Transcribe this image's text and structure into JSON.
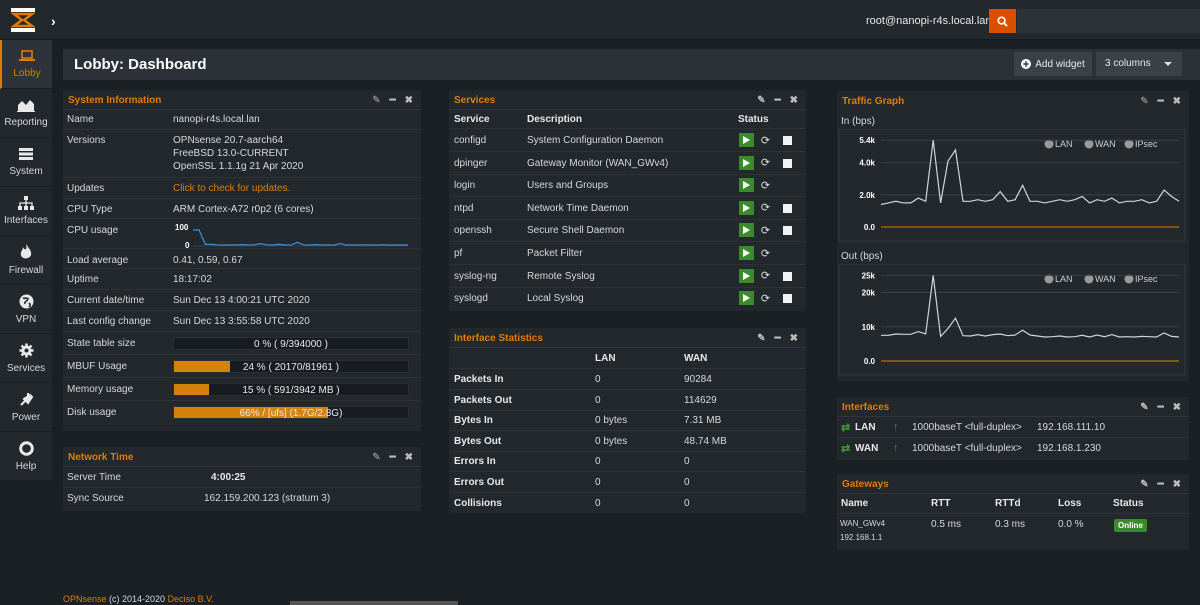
{
  "top": {
    "user": "root@nanopi-r4s.local.lan",
    "search_placeholder": ""
  },
  "sidebar": {
    "items": [
      {
        "label": "Lobby",
        "icon": "laptop-icon"
      },
      {
        "label": "Reporting",
        "icon": "area-chart-icon"
      },
      {
        "label": "System",
        "icon": "server-icon"
      },
      {
        "label": "Interfaces",
        "icon": "sitemap-icon"
      },
      {
        "label": "Firewall",
        "icon": "fire-icon"
      },
      {
        "label": "VPN",
        "icon": "globe-icon"
      },
      {
        "label": "Services",
        "icon": "cog-icon"
      },
      {
        "label": "Power",
        "icon": "plug-icon"
      },
      {
        "label": "Help",
        "icon": "lifebuoy-icon"
      }
    ]
  },
  "header": {
    "title": "Lobby: Dashboard",
    "add_widget": "Add widget",
    "columns": "3 columns"
  },
  "sysinfo": {
    "title": "System Information",
    "name_label": "Name",
    "name": "nanopi-r4s.local.lan",
    "versions_label": "Versions",
    "versions": [
      "OPNsense 20.7-aarch64",
      "FreeBSD 13.0-CURRENT",
      "OpenSSL 1.1.1g 21 Apr 2020"
    ],
    "updates_label": "Updates",
    "updates": "Click to check for updates.",
    "cpu_type_label": "CPU Type",
    "cpu_type": "ARM Cortex-A72 r0p2 (6 cores)",
    "cpu_usage_label": "CPU usage",
    "cpu_max": "100",
    "cpu_min": "0",
    "cpu_series": [
      80,
      80,
      8,
      8,
      6,
      5,
      6,
      5,
      7,
      5,
      6,
      12,
      6,
      5,
      8,
      5,
      6,
      18,
      6,
      5,
      7,
      5,
      6,
      5,
      12,
      5,
      6,
      5,
      6,
      5,
      5,
      6,
      5,
      5,
      5,
      5
    ],
    "load_label": "Load average",
    "load": "0.41, 0.59, 0.67",
    "uptime_label": "Uptime",
    "uptime": "18:17:02",
    "date_label": "Current date/time",
    "date": "Sun Dec 13 4:00:21 UTC 2020",
    "config_label": "Last config change",
    "config": "Sun Dec 13 3:55:58 UTC 2020",
    "state_label": "State table size",
    "state": "0 % ( 9/394000 )",
    "state_pct": 0,
    "mbuf_label": "MBUF Usage",
    "mbuf": "24 % ( 20170/81961 )",
    "mbuf_pct": 24,
    "mem_label": "Memory usage",
    "mem": "15 % ( 591/3942 MB )",
    "mem_pct": 15,
    "disk_label": "Disk usage",
    "disk": "66% / [ufs] (1.7G/2.8G)",
    "disk_pct": 66
  },
  "ntp": {
    "title": "Network Time",
    "server_label": "Server Time",
    "server": "4:00:25",
    "sync_label": "Sync Source",
    "sync": "162.159.200.123 (stratum 3)"
  },
  "services": {
    "title": "Services",
    "headers": [
      "Service",
      "Description",
      "Status"
    ],
    "rows": [
      {
        "name": "configd",
        "desc": "System Configuration Daemon",
        "stop": true
      },
      {
        "name": "dpinger",
        "desc": "Gateway Monitor (WAN_GWv4)",
        "stop": true
      },
      {
        "name": "login",
        "desc": "Users and Groups",
        "stop": false
      },
      {
        "name": "ntpd",
        "desc": "Network Time Daemon",
        "stop": true
      },
      {
        "name": "openssh",
        "desc": "Secure Shell Daemon",
        "stop": true
      },
      {
        "name": "pf",
        "desc": "Packet Filter",
        "stop": false
      },
      {
        "name": "syslog-ng",
        "desc": "Remote Syslog",
        "stop": true
      },
      {
        "name": "syslogd",
        "desc": "Local Syslog",
        "stop": true
      }
    ]
  },
  "ifstats": {
    "title": "Interface Statistics",
    "cols": [
      "LAN",
      "WAN"
    ],
    "rows": [
      {
        "label": "Packets In",
        "lan": "0",
        "wan": "90284"
      },
      {
        "label": "Packets Out",
        "lan": "0",
        "wan": "114629"
      },
      {
        "label": "Bytes In",
        "lan": "0 bytes",
        "wan": "7.31 MB"
      },
      {
        "label": "Bytes Out",
        "lan": "0 bytes",
        "wan": "48.74 MB"
      },
      {
        "label": "Errors In",
        "lan": "0",
        "wan": "0"
      },
      {
        "label": "Errors Out",
        "lan": "0",
        "wan": "0"
      },
      {
        "label": "Collisions",
        "lan": "0",
        "wan": "0"
      }
    ]
  },
  "traffic": {
    "title": "Traffic Graph",
    "in_label": "In (bps)",
    "out_label": "Out (bps)",
    "legend": [
      "LAN",
      "WAN",
      "IPsec"
    ],
    "in_ticks": [
      "5.4k",
      "4.0k",
      "2.0k",
      "0.0"
    ],
    "out_ticks": [
      "25k",
      "20k",
      "10k",
      "0.0"
    ],
    "in_ticks_v": [
      5400,
      4000,
      2000,
      0
    ],
    "out_ticks_v": [
      25000,
      20000,
      10000,
      0
    ],
    "in_max": 5600,
    "out_max": 26000,
    "in_wan": [
      1400,
      1500,
      1600,
      1500,
      1500,
      1800,
      1600,
      5400,
      1500,
      4100,
      4800,
      1600,
      1600,
      1700,
      1600,
      1700,
      2200,
      1600,
      1700,
      2600,
      1600,
      1600,
      1500,
      1600,
      1700,
      1600,
      1700,
      1900,
      1500,
      1700,
      1600,
      1800,
      1500,
      1600,
      1600,
      1700,
      1500,
      1600,
      2300,
      1900,
      1600
    ],
    "out_wan": [
      7500,
      7500,
      7900,
      7800,
      7800,
      8600,
      7900,
      25000,
      7200,
      9500,
      12500,
      7400,
      7300,
      7700,
      7300,
      7700,
      7900,
      7400,
      7600,
      9000,
      7600,
      7300,
      7000,
      7100,
      7300,
      7000,
      7100,
      7500,
      7000,
      7600,
      7100,
      7700,
      7000,
      7100,
      7000,
      7200,
      7100,
      7000,
      8200,
      7200,
      7000
    ]
  },
  "interfaces": {
    "title": "Interfaces",
    "rows": [
      {
        "name": "LAN",
        "media": "1000baseT <full-duplex>",
        "ip": "192.168.111.10"
      },
      {
        "name": "WAN",
        "media": "1000baseT <full-duplex>",
        "ip": "192.168.1.230"
      }
    ]
  },
  "gateways": {
    "title": "Gateways",
    "headers": [
      "Name",
      "RTT",
      "RTTd",
      "Loss",
      "Status"
    ],
    "rows": [
      {
        "name": "WAN_GWv4",
        "addr": "192.168.1.1",
        "rtt": "0.5 ms",
        "rttd": "0.3 ms",
        "loss": "0.0 %",
        "status": "Online"
      }
    ]
  },
  "footer": {
    "brand": "OPNsense",
    "rest": " (c) 2014-2020 ",
    "company": "Deciso B.V."
  },
  "colors": {
    "accent": "#e07b00",
    "online": "#3c8a2e",
    "bar": "#d5820c",
    "line": "#d0d4e0",
    "cpu": "#3f8fd8"
  }
}
